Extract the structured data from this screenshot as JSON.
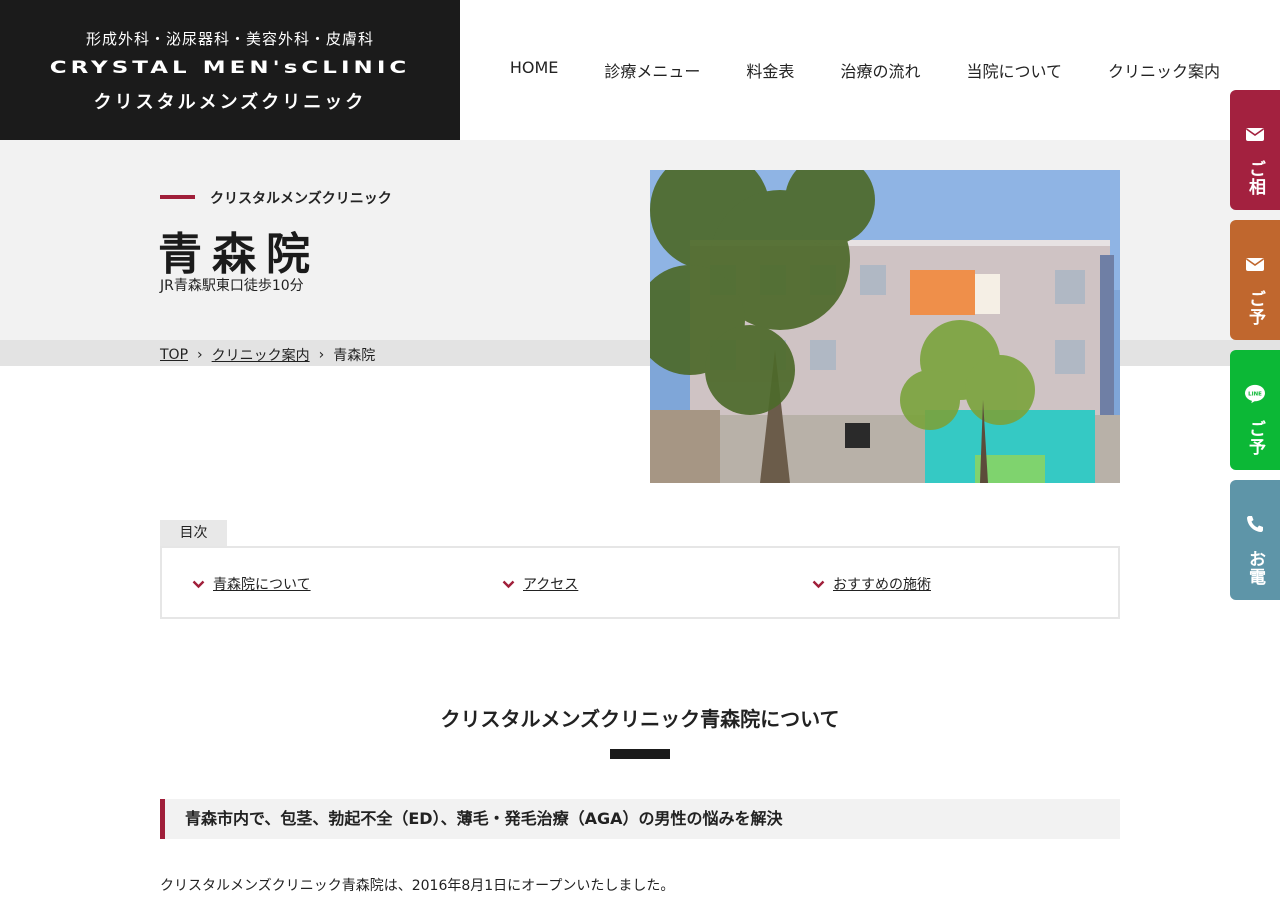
{
  "logo": {
    "sub": "形成外科・泌尿器科・美容外科・皮膚科",
    "en": "CRYSTAL MEN'sCLINIC",
    "ja": "クリスタルメンズクリニック"
  },
  "nav": [
    "HOME",
    "診療メニュー",
    "料金表",
    "治療の流れ",
    "当院について",
    "クリニック案内"
  ],
  "hero": {
    "small": "クリスタルメンズクリニック",
    "title": "青森院",
    "desc": "JR青森駅東口徒歩10分"
  },
  "breadcrumb": [
    "TOP",
    "クリニック案内",
    "青森院"
  ],
  "toc": {
    "label": "目次",
    "items": [
      "青森院について",
      "アクセス",
      "おすすめの施術"
    ]
  },
  "section": {
    "title": "クリスタルメンズクリニック青森院について",
    "h3": "青森市内で、包茎、勃起不全（ED）、薄毛・発毛治療（AGA）の男性の悩みを解決",
    "body": "クリスタルメンズクリニック青森院は、2016年8月1日にオープンいたしました。"
  },
  "side_buttons": [
    {
      "label": "ご相談",
      "icon": "mail-icon",
      "color": "#a3213f"
    },
    {
      "label": "ご予約",
      "icon": "mail-icon",
      "color": "#c0672e"
    },
    {
      "label": "ご予約",
      "icon": "line-icon",
      "color": "#0cb836"
    },
    {
      "label": "お電話",
      "icon": "phone-icon",
      "color": "#5e95a8"
    }
  ]
}
